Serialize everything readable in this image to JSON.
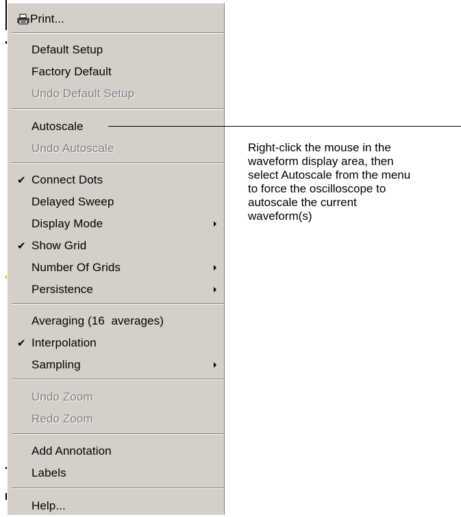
{
  "menu": {
    "print_label": "Print...",
    "default_setup": "Default Setup",
    "factory_default": "Factory Default",
    "undo_default_setup": "Undo Default Setup",
    "autoscale": "Autoscale",
    "undo_autoscale": "Undo Autoscale",
    "connect_dots": "Connect Dots",
    "delayed_sweep": "Delayed Sweep",
    "display_mode": "Display Mode",
    "show_grid": "Show Grid",
    "number_of_grids": "Number Of Grids",
    "persistence": "Persistence",
    "averaging": "Averaging (16  averages)",
    "interpolation": "Interpolation",
    "sampling": "Sampling",
    "undo_zoom": "Undo Zoom",
    "redo_zoom": "Redo Zoom",
    "add_annotation": "Add Annotation",
    "labels": "Labels",
    "help": "Help...",
    "check_mark": "✔"
  },
  "annotation": {
    "lines": [
      "Right-click the mouse in the",
      "waveform display area, then",
      "select Autoscale from the menu",
      "to force the oscilloscope to",
      "autoscale the current",
      "waveform(s)"
    ]
  },
  "icons": {
    "print": "printer-icon",
    "check": "check-icon",
    "submenu": "submenu-arrow-icon"
  },
  "colors": {
    "menu_bg": "#d4d0c8",
    "disabled_text": "#808080",
    "highlight": "#ffffff"
  }
}
